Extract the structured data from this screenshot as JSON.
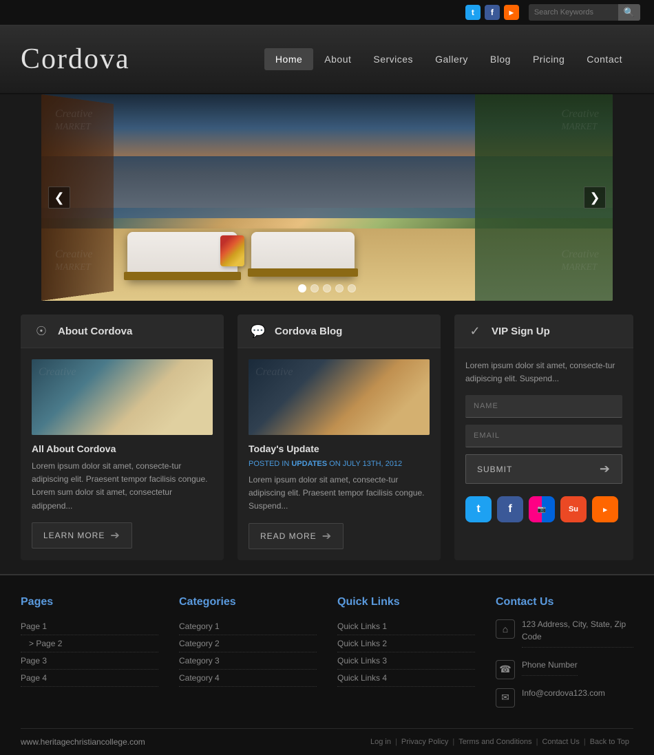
{
  "topbar": {
    "search_placeholder": "Search Keywords"
  },
  "header": {
    "logo": "Cordova",
    "nav": [
      {
        "label": "Home",
        "active": true
      },
      {
        "label": "About",
        "active": false
      },
      {
        "label": "Services",
        "active": false
      },
      {
        "label": "Gallery",
        "active": false
      },
      {
        "label": "Blog",
        "active": false
      },
      {
        "label": "Pricing",
        "active": false
      },
      {
        "label": "Contact",
        "active": false
      }
    ]
  },
  "slider": {
    "prev_label": "❮",
    "next_label": "❯",
    "dots": [
      1,
      2,
      3,
      4,
      5
    ],
    "active_dot": 0
  },
  "about_section": {
    "title": "About Cordova",
    "post_title": "All About Cordova",
    "text": "Lorem ipsum dolor sit amet, consecte-tur adipiscing elit. Praesent tempor facilisis congue. Lorem sum dolor sit amet, consectetur adippend...",
    "btn_label": "LEARN MORE"
  },
  "blog_section": {
    "title": "Cordova Blog",
    "post_title": "Today's Update",
    "meta_prefix": "Posted in ",
    "meta_tag": "UPDATES",
    "meta_date": "on July 13th, 2012",
    "text": "Lorem ipsum dolor sit amet, consecte-tur adipiscing elit. Praesent tempor facilisis congue. Suspend...",
    "btn_label": "READ MORE"
  },
  "vip_section": {
    "title": "VIP Sign Up",
    "desc": "Lorem ipsum dolor sit amet, consecte-tur adipiscing elit. Suspend...",
    "name_placeholder": "NAME",
    "email_placeholder": "EMAIL",
    "submit_label": "SUBMIT"
  },
  "footer": {
    "pages_title": "Pages",
    "pages": [
      {
        "label": "Page 1",
        "indent": false
      },
      {
        "label": ">  Page 2",
        "indent": false
      },
      {
        "label": "Page 3",
        "indent": false
      },
      {
        "label": "Page 4",
        "indent": false
      }
    ],
    "categories_title": "Categories",
    "categories": [
      {
        "label": "Category 1"
      },
      {
        "label": "Category 2"
      },
      {
        "label": "Category 3"
      },
      {
        "label": "Category 4"
      }
    ],
    "quicklinks_title": "Quick Links",
    "quicklinks": [
      {
        "label": "Quick Links 1"
      },
      {
        "label": "Quick Links 2"
      },
      {
        "label": "Quick Links 3"
      },
      {
        "label": "Quick Links 4"
      }
    ],
    "contact_title": "Contact Us",
    "address": "123 Address, City, State, Zip Code",
    "phone": "Phone Number",
    "email": "Info@cordova123.com",
    "site_url": "www.heritagechristiancollege.com",
    "bottom_links": [
      {
        "label": "Log in"
      },
      {
        "label": "Privacy Policy"
      },
      {
        "label": "Terms and Conditions"
      },
      {
        "label": "Contact Us"
      },
      {
        "label": "Back to Top"
      }
    ]
  }
}
